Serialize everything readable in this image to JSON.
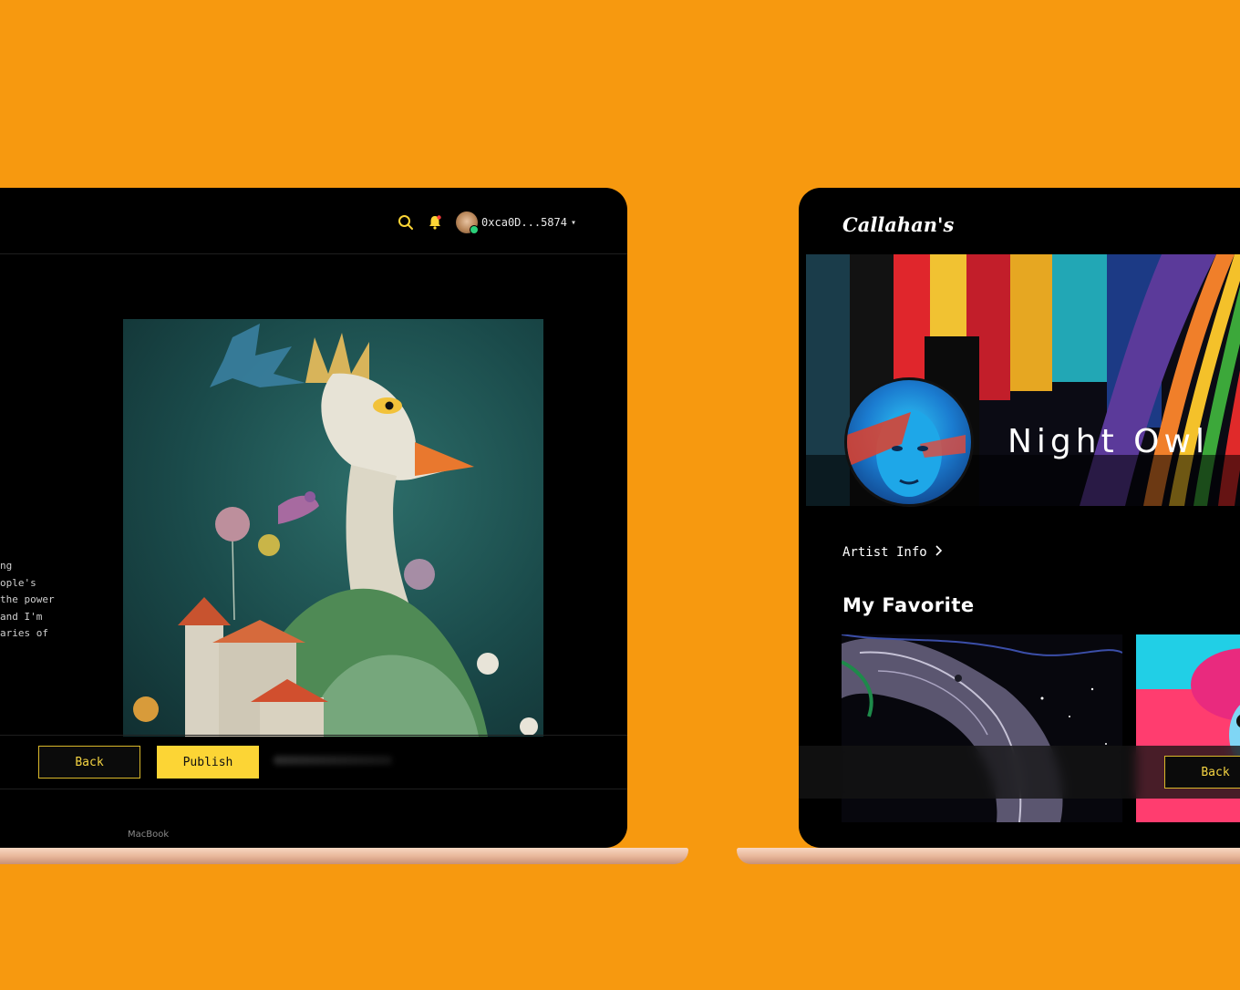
{
  "left_app": {
    "wallet_address": "0xca0D...5874",
    "description_lines": [
      "ng",
      "ople's",
      "the power",
      "and I'm",
      "aries of"
    ],
    "back_label": "Back",
    "publish_label": "Publish",
    "device_label": "MacBook"
  },
  "right_app": {
    "logo": "Callahan's",
    "artist_name": "Night Owl",
    "artist_info_label": "Artist Info",
    "section_title": "My Favorite",
    "back_label": "Back"
  },
  "colors": {
    "background": "#f7990f",
    "accent_yellow": "#fcd535",
    "screen_bg": "#000000"
  },
  "icons": [
    "search-icon",
    "bell-icon",
    "chevron-down-icon",
    "chevron-right-icon"
  ]
}
